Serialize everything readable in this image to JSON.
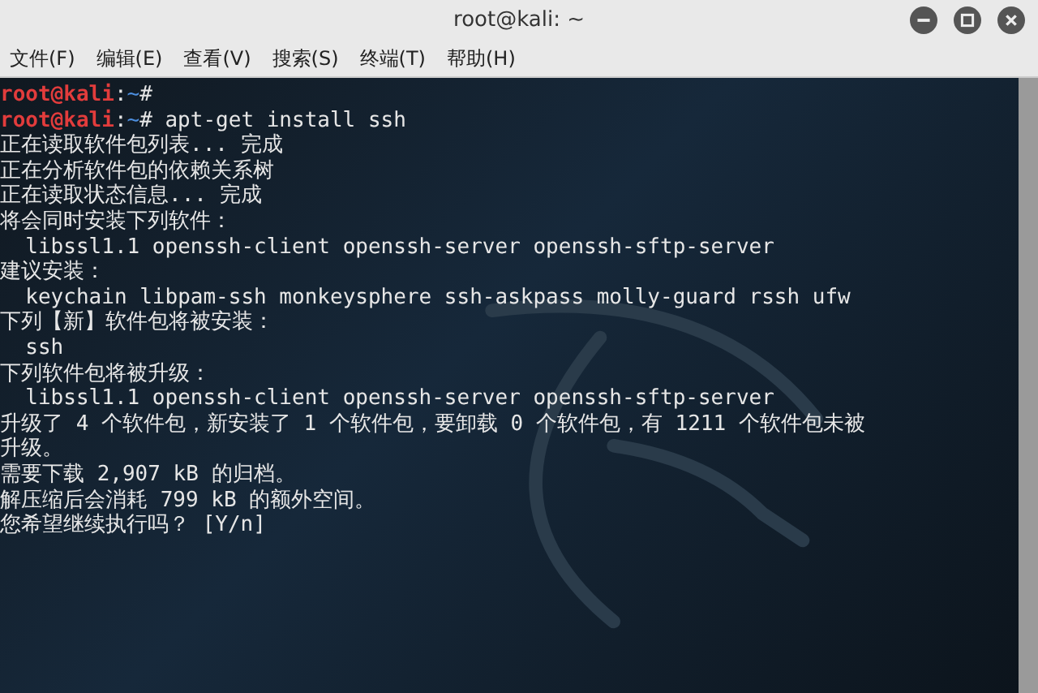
{
  "window": {
    "title": "root@kali: ~"
  },
  "menu": [
    "文件(F)",
    "编辑(E)",
    "查看(V)",
    "搜索(S)",
    "终端(T)",
    "帮助(H)"
  ],
  "terminal": {
    "lines": [
      {
        "kind": "prompt",
        "user": "root@kali",
        "separator": ":",
        "path": "~",
        "symbol": "#"
      },
      {
        "kind": "prompt",
        "user": "root@kali",
        "separator": ":",
        "path": "~",
        "symbol": "#",
        "command": "apt-get install ssh"
      },
      {
        "kind": "output",
        "text": "正在读取软件包列表... 完成"
      },
      {
        "kind": "output",
        "text": "正在分析软件包的依赖关系树"
      },
      {
        "kind": "output",
        "text": "正在读取状态信息... 完成"
      },
      {
        "kind": "output",
        "text": "将会同时安装下列软件："
      },
      {
        "kind": "output",
        "text": "  libssl1.1 openssh-client openssh-server openssh-sftp-server"
      },
      {
        "kind": "output",
        "text": "建议安装："
      },
      {
        "kind": "output",
        "text": "  keychain libpam-ssh monkeysphere ssh-askpass molly-guard rssh ufw"
      },
      {
        "kind": "output",
        "text": "下列【新】软件包将被安装："
      },
      {
        "kind": "output",
        "text": "  ssh"
      },
      {
        "kind": "output",
        "text": "下列软件包将被升级："
      },
      {
        "kind": "output",
        "text": "  libssl1.1 openssh-client openssh-server openssh-sftp-server"
      },
      {
        "kind": "output",
        "text": "升级了 4 个软件包，新安装了 1 个软件包，要卸载 0 个软件包，有 1211 个软件包未被"
      },
      {
        "kind": "output",
        "text": "升级。"
      },
      {
        "kind": "output",
        "text": "需要下载 2,907 kB 的归档。"
      },
      {
        "kind": "output",
        "text": "解压缩后会消耗 799 kB 的额外空间。"
      },
      {
        "kind": "output",
        "text": "您希望继续执行吗？ [Y/n]"
      }
    ]
  }
}
